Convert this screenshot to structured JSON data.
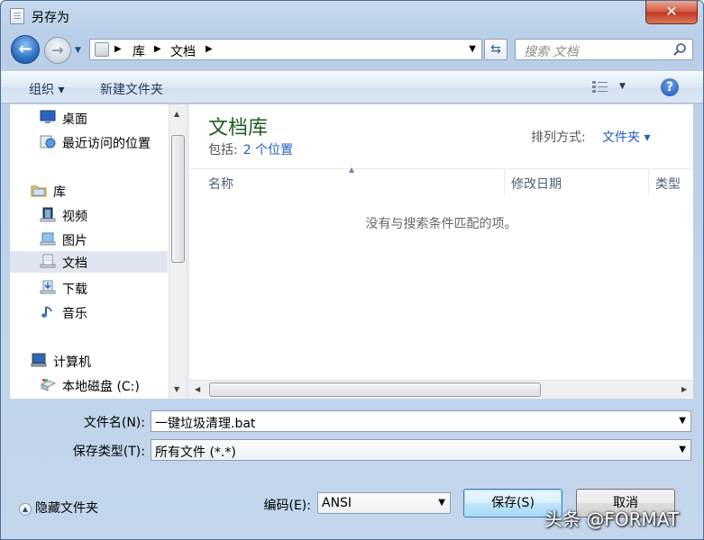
{
  "window": {
    "title": "另存为",
    "close_glyph": "✕"
  },
  "address": {
    "crumbs": [
      "库",
      "文档"
    ],
    "search_placeholder": "搜索 文档"
  },
  "toolbar": {
    "organize": "组织 ▾",
    "new_folder": "新建文件夹"
  },
  "nav": {
    "items": [
      {
        "label": "桌面",
        "icon": "desktop-icon"
      },
      {
        "label": "最近访问的位置",
        "icon": "recent-places-icon"
      },
      {
        "label": "库",
        "icon": "libraries-icon"
      },
      {
        "label": "视频",
        "icon": "videos-icon"
      },
      {
        "label": "图片",
        "icon": "pictures-icon"
      },
      {
        "label": "文档",
        "icon": "documents-icon",
        "selected": true
      },
      {
        "label": "下载",
        "icon": "downloads-icon"
      },
      {
        "label": "音乐",
        "icon": "music-icon"
      },
      {
        "label": "计算机",
        "icon": "computer-icon"
      },
      {
        "label": "本地磁盘 (C:)",
        "icon": "local-disk-icon"
      }
    ]
  },
  "content": {
    "library_title": "文档库",
    "includes_label": "包括:",
    "includes_link": "2 个位置",
    "arrange_label": "排列方式:",
    "arrange_value": "文件夹 ▾",
    "columns": [
      "名称",
      "修改日期",
      "类型"
    ],
    "empty_message": "没有与搜索条件匹配的项。"
  },
  "form": {
    "filename_label": "文件名(N):",
    "filename_value": "一键垃圾清理.bat",
    "filetype_label": "保存类型(T):",
    "filetype_value": "所有文件 (*.*)",
    "encoding_label": "编码(E):",
    "encoding_value": "ANSI"
  },
  "footer": {
    "hide_folders": "隐藏文件夹",
    "save_button": "保存(S)",
    "cancel_button": "取消"
  },
  "watermark": "头条 @FORMAT",
  "colors": {
    "library_title": "#1e5e1e",
    "link": "#1f5fbd",
    "close": "#c7422a"
  }
}
